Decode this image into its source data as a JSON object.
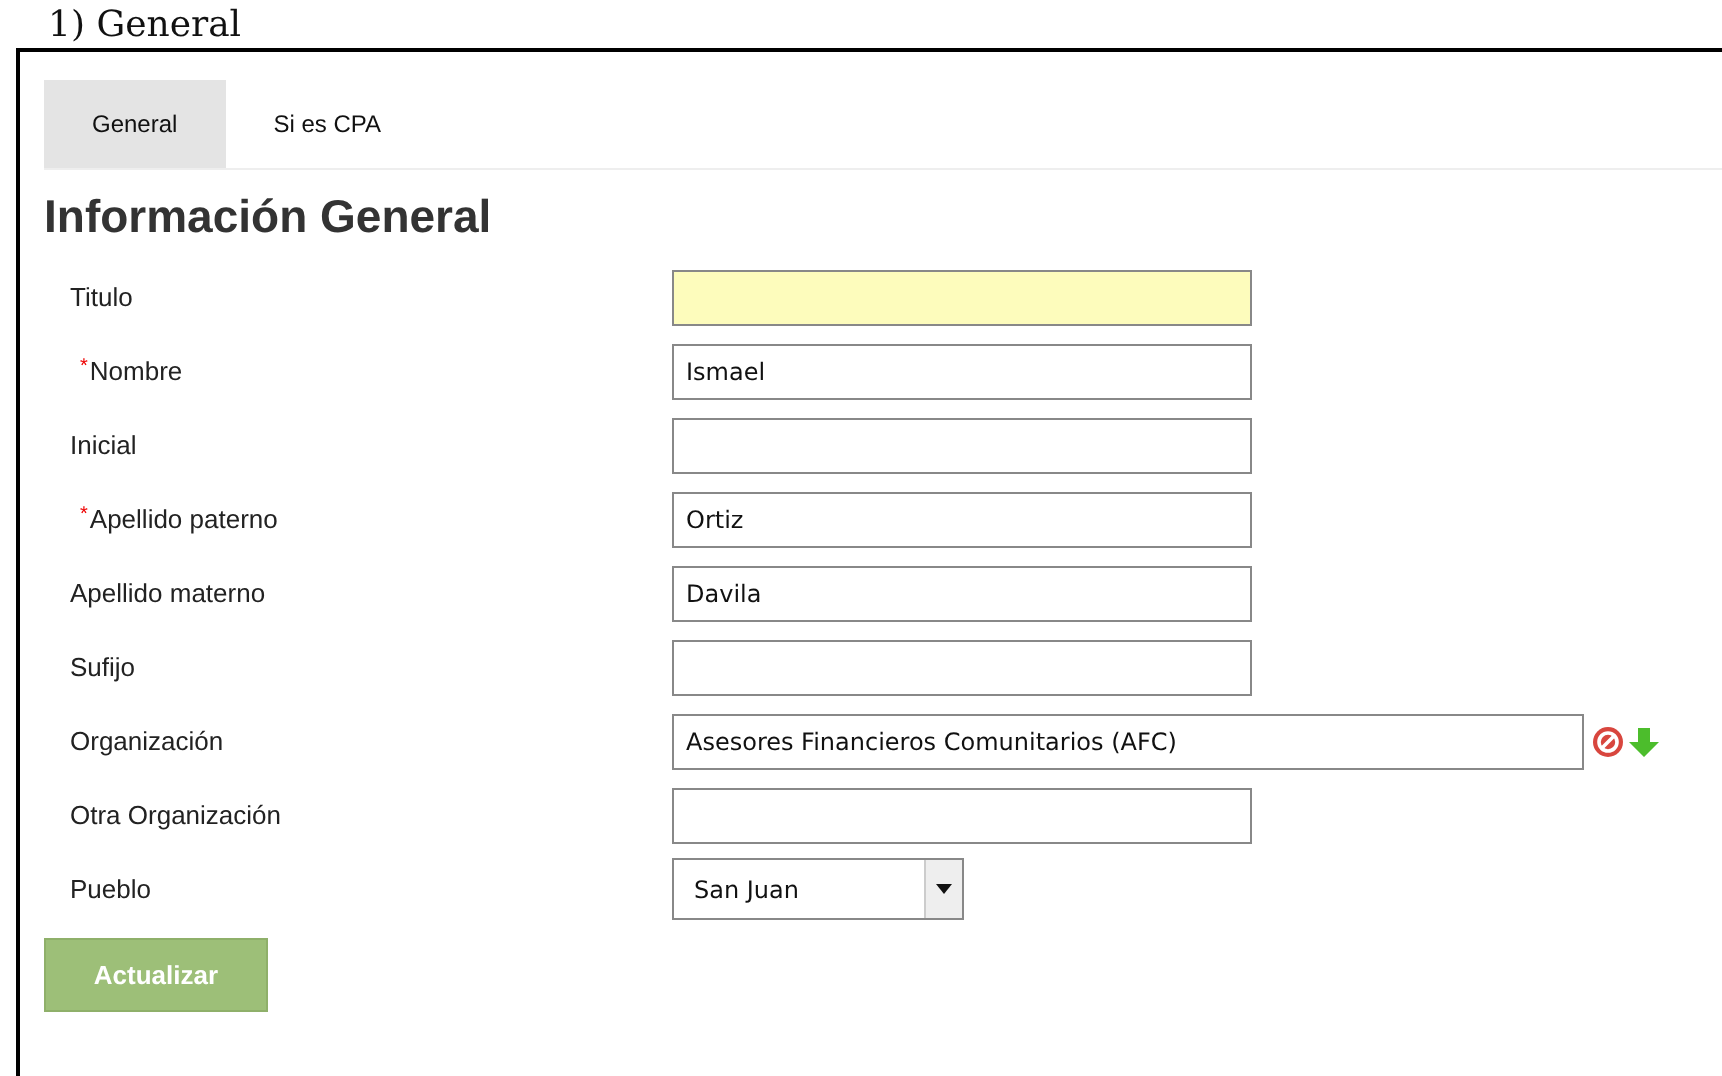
{
  "caption": "1) General",
  "tabs": [
    {
      "label": "General",
      "selected": true
    },
    {
      "label": "Si es CPA",
      "selected": false
    }
  ],
  "section_title": "Información General",
  "required_marker": "*",
  "fields": [
    {
      "label": "Titulo",
      "required": false,
      "kind": "text",
      "focused": true
    },
    {
      "label": "Nombre",
      "required": true,
      "kind": "text",
      "value": "Ismael",
      "focused": false
    },
    {
      "label": "Inicial",
      "required": false,
      "kind": "text",
      "focused": false
    },
    {
      "label": "Apellido paterno",
      "required": true,
      "kind": "text",
      "value": "Ortiz",
      "focused": false
    },
    {
      "label": "Apellido materno",
      "required": false,
      "kind": "text",
      "value": "Davila",
      "focused": false
    },
    {
      "label": "Sufijo",
      "required": false,
      "kind": "text",
      "focused": false
    },
    {
      "label": "Organización",
      "required": false,
      "kind": "lookup",
      "value": "Asesores Financieros Comunitarios (AFC)",
      "focused": false
    },
    {
      "label": "Otra Organización",
      "required": false,
      "kind": "text",
      "focused": false
    },
    {
      "label": "Pueblo",
      "required": false,
      "kind": "select",
      "value": "San Juan",
      "focused": false
    }
  ],
  "submit_button": "Actualizar"
}
